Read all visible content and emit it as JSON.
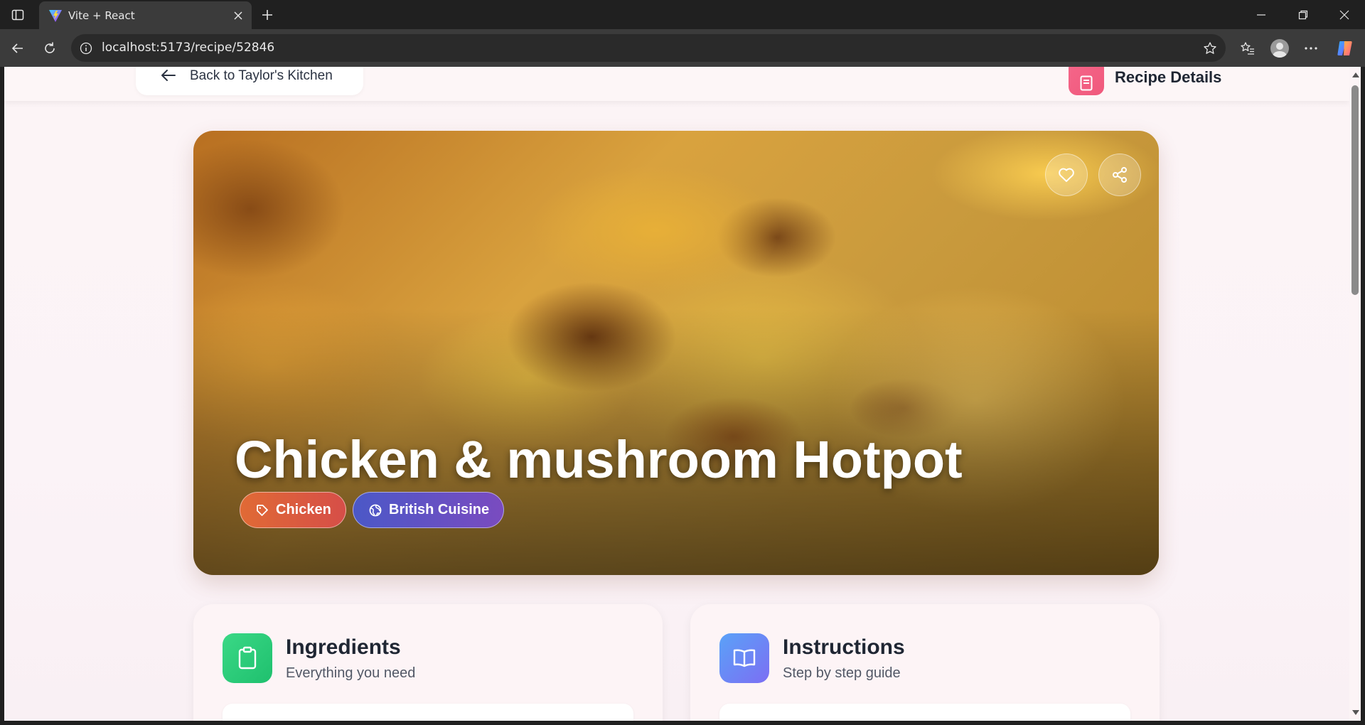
{
  "browser": {
    "tab_title": "Vite + React",
    "url": "localhost:5173/recipe/52846"
  },
  "header": {
    "back_label": "Back to Taylor's Kitchen",
    "page_title": "Recipe Details",
    "accent_color": "#f5668a"
  },
  "recipe": {
    "title": "Chicken & mushroom Hotpot",
    "category": "Chicken",
    "cuisine": "British Cuisine"
  },
  "sections": {
    "ingredients": {
      "title": "Ingredients",
      "subtitle": "Everything you need",
      "color": "#2ecf7c"
    },
    "instructions": {
      "title": "Instructions",
      "subtitle": "Step by step guide",
      "color": "#6a7bf5"
    }
  },
  "icons": {
    "favorite": "heart-icon",
    "share": "share-icon",
    "category": "tag-icon",
    "cuisine": "globe-icon",
    "ingredients": "clipboard-icon",
    "instructions": "book-open-icon"
  }
}
